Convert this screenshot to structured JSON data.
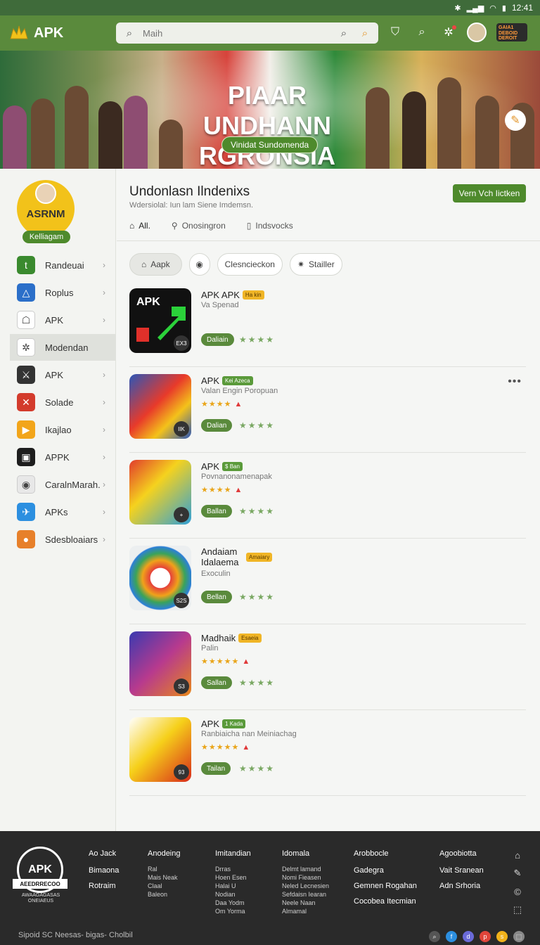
{
  "status_bar": {
    "time": "12:41"
  },
  "app_bar": {
    "logo_text": "APK",
    "search_placeholder": "Maih",
    "profile_badge_text": "GAIA1 DEBOID DEROIT"
  },
  "banner": {
    "title_line1": "PIAAR UNDHANN",
    "title_line2": "RGRONSIA",
    "cta": "Vinidat Sundomenda"
  },
  "sidebar": {
    "profile_name": "ASRNM",
    "profile_tag": "Kelliagam",
    "items": [
      {
        "label": "Randeuai",
        "icon": "tiktok-icon",
        "color": "#3a8a2e"
      },
      {
        "label": "Roplus",
        "icon": "delta-icon",
        "color": "#2b6fc9"
      },
      {
        "label": "APK",
        "icon": "android-icon",
        "color": "#ffffff"
      },
      {
        "label": "Modendan",
        "icon": "puzzle-icon",
        "color": "#ffffff"
      },
      {
        "label": "APK",
        "icon": "game-icon",
        "color": "#333333"
      },
      {
        "label": "Solade",
        "icon": "cross-icon",
        "color": "#d33b2c"
      },
      {
        "label": "Ikajlao",
        "icon": "play-icon",
        "color": "#f2a51a"
      },
      {
        "label": "APPK",
        "icon": "apk-icon",
        "color": "#1d1d1d"
      },
      {
        "label": "CaralnMarah.",
        "icon": "chrome-icon",
        "color": "#e8e8e8"
      },
      {
        "label": "APKs",
        "icon": "twitter-icon",
        "color": "#2c8fe0"
      },
      {
        "label": "Sdesbloaiars",
        "icon": "orange-game-icon",
        "color": "#e7802a"
      }
    ]
  },
  "main": {
    "title": "Undonlasn Ilndenixs",
    "subtitle": "Wdersiolal: Iun lam Siene Imdemsn.",
    "primary_button": "Vern Vch Iictken",
    "tabs": [
      {
        "label": "All."
      },
      {
        "label": "Onosingron"
      },
      {
        "label": "Indsvocks"
      }
    ],
    "filters": [
      {
        "label": "Aapk"
      },
      {
        "label": ""
      },
      {
        "label": "Clesncieckon"
      },
      {
        "label": "Stailler"
      }
    ],
    "apps": [
      {
        "title": "APK APK",
        "tag": "Ha kin",
        "tag_color": "yellow",
        "subtitle": "Va Spenad",
        "stars": "",
        "button": "Daliain",
        "corner": "EX3"
      },
      {
        "title": "APK",
        "tag": "Kei Azeca",
        "tag_color": "green",
        "subtitle": "Valan Engin Poropuan",
        "stars": "★★★★",
        "button": "Dalian",
        "corner": "IIK"
      },
      {
        "title": "APK",
        "tag": "$ Ban",
        "tag_color": "green",
        "subtitle": "Povnanonamenapak",
        "stars": "★★★★",
        "button": "Ballan",
        "corner": "+"
      },
      {
        "title": "Andaiam Idalaema",
        "tag": "Amaiary",
        "tag_color": "yellow",
        "subtitle": "Exoculin",
        "stars": "",
        "button": "Bellan",
        "corner": "S2S"
      },
      {
        "title": "Madhaik",
        "tag": "Esaeia",
        "tag_color": "yellow",
        "subtitle": "Palin",
        "stars": "★★★★★",
        "button": "Sallan",
        "corner": "S3"
      },
      {
        "title": "APK",
        "tag": "1 Kada",
        "tag_color": "green",
        "subtitle": "Ranbiaicha nan Meiniachag",
        "stars": "★★★★★",
        "button": "Tailan",
        "corner": "93"
      }
    ]
  },
  "footer": {
    "logo_text": "APK",
    "logo_band": "AEEDRRECOO",
    "logo_caption": "AWAAGAGASAS ONEIAEUS",
    "columns": [
      {
        "heading": "Ao Jack",
        "items": [
          "Bimaona",
          "Rotraim"
        ]
      },
      {
        "heading": "Anodeing",
        "items": [
          "Ral",
          "Mais Neak",
          "Claal",
          "Baleon"
        ]
      },
      {
        "heading": "Imitandian",
        "items": [
          "Drras",
          "Hoen Esen",
          "Halai U",
          "Nodian",
          "Daa Yodm",
          "Om Yorma"
        ]
      },
      {
        "heading": "Idomala",
        "items": [
          "Delmt lamand",
          "Nomi Fieasen",
          "Neled Lecnesien",
          "Sefdaisn Iearan",
          "Neele Naan",
          "Almamal"
        ]
      },
      {
        "heading": "Arobbocle",
        "items": [
          "Gadegra",
          "Gemnen Rogahan",
          "Cocobea Itecmian"
        ]
      },
      {
        "heading": "Agoobiotta",
        "items": [
          "Vait Sranean",
          "Adn Srhoria"
        ]
      }
    ],
    "copyright": "Sipoid SC Neesas- bigas- Cholbil"
  }
}
